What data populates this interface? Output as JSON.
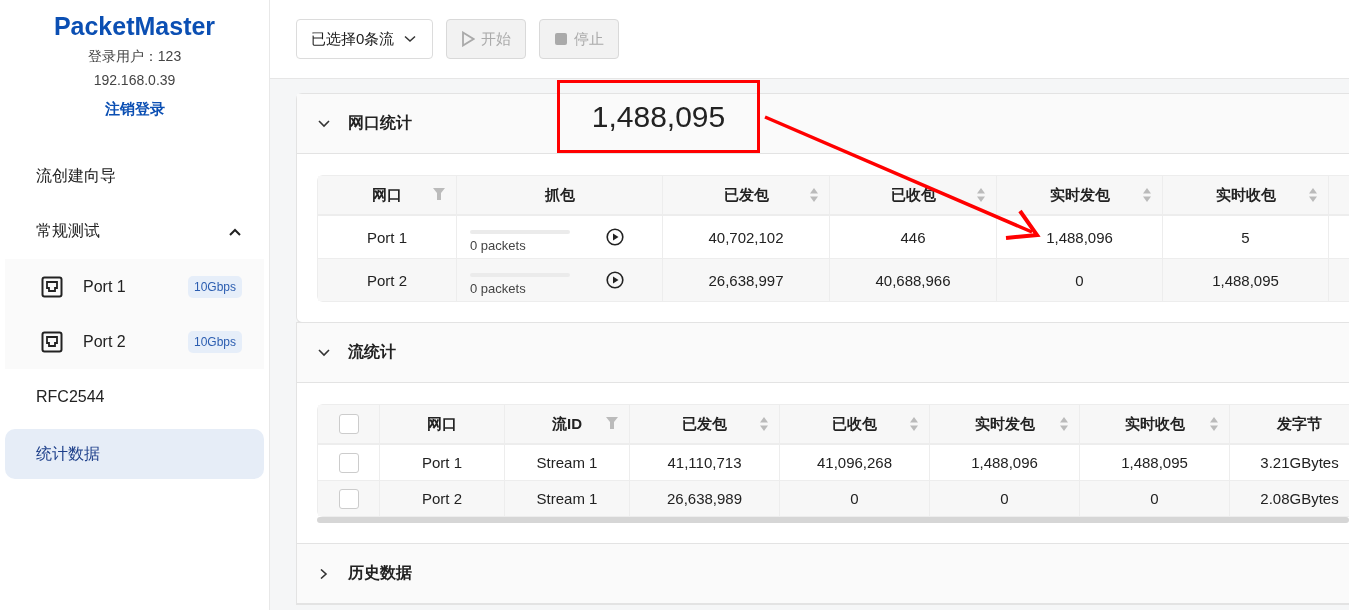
{
  "sidebar": {
    "logo": "PacketMaster",
    "user": "登录用户：123",
    "ip": "192.168.0.39",
    "logout": "注销登录",
    "items": [
      {
        "kind": "item",
        "label": "流创建向导",
        "selected": false
      },
      {
        "kind": "group",
        "label": "常规测试",
        "selected": false,
        "expanded": true,
        "children": [
          {
            "label": "Port 1",
            "badge": "10Gbps",
            "selected": false
          },
          {
            "label": "Port 2",
            "badge": "10Gbps",
            "selected": false
          }
        ]
      },
      {
        "kind": "item",
        "label": "RFC2544",
        "selected": false
      },
      {
        "kind": "item",
        "label": "统计数据",
        "selected": true
      }
    ]
  },
  "toolbar": {
    "stream_select": "已选择0条流",
    "buttons": [
      {
        "kind": "play",
        "label": "开始",
        "disabled": true
      },
      {
        "kind": "stop",
        "label": "停止",
        "disabled": true
      }
    ]
  },
  "sections": [
    {
      "title": "网口统计",
      "expanded": true,
      "table": {
        "columns": [
          {
            "label": "网口",
            "kind": "filter"
          },
          {
            "label": "抓包",
            "kind": "plain"
          },
          {
            "label": "已发包",
            "kind": "sort"
          },
          {
            "label": "已收包",
            "kind": "sort"
          },
          {
            "label": "实时发包",
            "kind": "sort"
          },
          {
            "label": "实时收包",
            "kind": "sort"
          }
        ],
        "rows": [
          {
            "cells": [
              "Port 1",
              {
                "kind": "capture",
                "caption": "0 packets",
                "level": 0
              },
              "40,702,102",
              "446",
              "1,488,096",
              "5"
            ]
          },
          {
            "cells": [
              "Port 2",
              {
                "kind": "capture",
                "caption": "0 packets",
                "level": 0
              },
              "26,638,997",
              "40,688,966",
              "0",
              "1,488,095"
            ]
          }
        ]
      }
    },
    {
      "title": "流统计",
      "expanded": true,
      "table": {
        "all_checked": false,
        "columns": [
          {
            "label": "网口",
            "kind": "plain"
          },
          {
            "label": "流ID",
            "kind": "filter"
          },
          {
            "label": "已发包",
            "kind": "sort"
          },
          {
            "label": "已收包",
            "kind": "sort"
          },
          {
            "label": "实时发包",
            "kind": "sort"
          },
          {
            "label": "实时收包",
            "kind": "sort"
          },
          {
            "label": "发字节",
            "kind": "plain"
          }
        ],
        "rows": [
          {
            "checked": false,
            "cells": [
              "Port 1",
              "Stream 1",
              "41,110,713",
              "41,096,268",
              "1,488,096",
              "1,488,095",
              "3.21GBytes"
            ]
          },
          {
            "checked": false,
            "cells": [
              "Port 2",
              "Stream 1",
              "26,638,989",
              "0",
              "0",
              "0",
              "2.08GBytes"
            ]
          }
        ]
      }
    },
    {
      "title": "历史数据",
      "expanded": false
    }
  ],
  "annotation": {
    "value": "1,488,095"
  }
}
